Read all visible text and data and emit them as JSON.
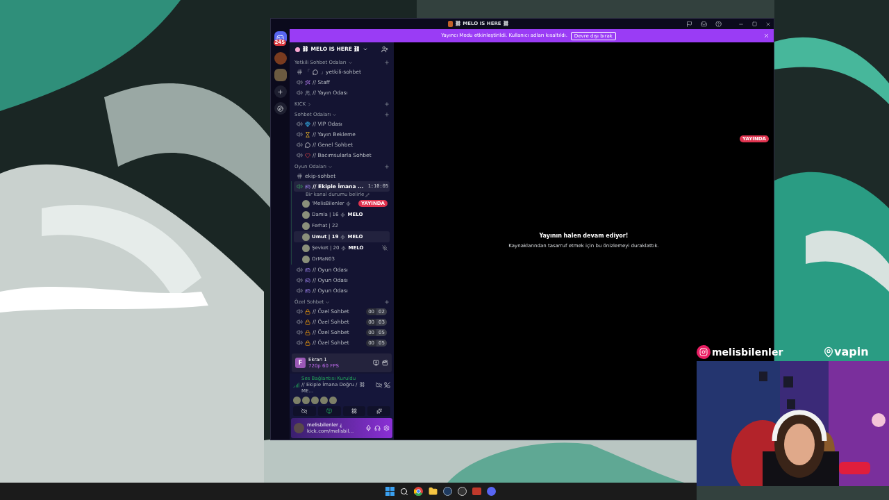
{
  "window": {
    "title": "⛓ MELO IS HERE ⛓"
  },
  "banner": {
    "text": "Yayıncı Modu etkinleştirildi. Kullanıcı adları kısaltıldı.",
    "button": "Devre dışı bırak"
  },
  "rail": {
    "badge": "245"
  },
  "server": {
    "name": "⛓ MELO IS HERE ⛓"
  },
  "categories": [
    {
      "name": "Yetkili Sohbet Odaları",
      "expanded": true,
      "channels": [
        {
          "kind": "text",
          "prefix": "「",
          "name": "」yetkili-sohbet",
          "connected": false
        },
        {
          "kind": "voice",
          "name": "// Staff",
          "connected": false
        },
        {
          "kind": "voice",
          "name": "// Yayın Odası",
          "connected": false
        }
      ]
    },
    {
      "name": "KICK",
      "expanded": false
    },
    {
      "name": "Sohbet Odaları",
      "expanded": true,
      "channels": [
        {
          "kind": "voice",
          "name": "// VIP Odası",
          "connected": false
        },
        {
          "kind": "voice",
          "name": "// Yayın Bekleme",
          "connected": false
        },
        {
          "kind": "voice",
          "name": "// Genel Sohbet",
          "connected": false
        },
        {
          "kind": "voice",
          "name": "// Bacımsularla Sohbet",
          "connected": false
        }
      ]
    },
    {
      "name": "Oyun Odaları",
      "expanded": true,
      "channels": [
        {
          "kind": "text",
          "name": "ekip-sohbet",
          "connected": false
        },
        {
          "kind": "voice",
          "name": "// Ekiple İmana ...",
          "connected": true,
          "time": "1:10:05",
          "status": "Bir kanal durumu belirle",
          "members": [
            {
              "name": "'MelisBilenler",
              "boost": true,
              "badge": "YAYINDA",
              "muted": false,
              "highlighted": false
            },
            {
              "name": "Damla | 16",
              "boost": true,
              "tag": "MELO",
              "muted": false,
              "highlighted": false
            },
            {
              "name": "Ferhat | 22",
              "boost": false,
              "muted": false,
              "highlighted": false
            },
            {
              "name": "Umut | 19",
              "boost": true,
              "tag": "MELO",
              "muted": false,
              "highlighted": true
            },
            {
              "name": "Şevket | 20",
              "boost": true,
              "tag": "MELO",
              "muted": true,
              "highlighted": false
            },
            {
              "name": "OrMaN03",
              "boost": false,
              "muted": false,
              "highlighted": false
            }
          ]
        },
        {
          "kind": "voice",
          "name": "// Oyun Odası",
          "connected": false
        },
        {
          "kind": "voice",
          "name": "// Oyun Odası",
          "connected": false
        },
        {
          "kind": "voice",
          "name": "// Oyun Odası",
          "connected": false
        }
      ]
    },
    {
      "name": "Özel Sohbet",
      "expanded": true,
      "channels": [
        {
          "kind": "voice",
          "name": "// Özel Sohbet",
          "connected": false,
          "counts": [
            "00",
            "02"
          ]
        },
        {
          "kind": "voice",
          "name": "// Özel Sohbet",
          "connected": false,
          "counts": [
            "00",
            "03"
          ]
        },
        {
          "kind": "voice",
          "name": "// Özel Sohbet",
          "connected": false,
          "counts": [
            "00",
            "05"
          ]
        },
        {
          "kind": "voice",
          "name": "// Özel Sohbet",
          "connected": false,
          "counts": [
            "00",
            "05"
          ]
        }
      ]
    }
  ],
  "stream_panel": {
    "letter": "F",
    "title": "Ekran 1",
    "quality": "720p 60 FPS"
  },
  "voice_panel": {
    "status": "Ses Bağlantısı Kuruldu",
    "channel": "// Ekiple İmana Doğru / ⛓ ME..."
  },
  "user": {
    "name": "melisbilenler ¿",
    "status": "kick.com/melisbil..."
  },
  "preview": {
    "badge": "YAYINDA",
    "title": "Yayının halen devam ediyor!",
    "text": "Kaynaklarından tasarruf etmek için bu önizlemeyi duraklattık."
  },
  "overlay": {
    "instagram": "melisbilenler",
    "logo": "vapin"
  }
}
